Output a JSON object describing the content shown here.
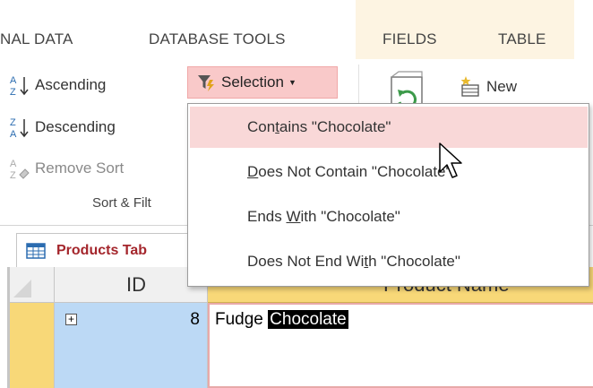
{
  "tabs": [
    {
      "label": "NAL DATA"
    },
    {
      "label": "DATABASE TOOLS"
    },
    {
      "label": "FIELDS"
    },
    {
      "label": "TABLE"
    }
  ],
  "ribbon": {
    "ascending": "Ascending",
    "descending": "Descending",
    "remove_sort": "Remove Sort",
    "selection": "Selection",
    "new": "New",
    "group_label": "Sort & Filt"
  },
  "menu": {
    "items": [
      {
        "before": "Con",
        "key": "t",
        "after": "ains \"Chocolate\"",
        "state": "hover"
      },
      {
        "before": "",
        "key": "D",
        "after": "oes Not Contain \"Chocolate\"",
        "state": "normal"
      },
      {
        "before": "Ends ",
        "key": "W",
        "after": "ith \"Chocolate\"",
        "state": "normal"
      },
      {
        "before": "Does Not End Wi",
        "key": "t",
        "after": "h \"Chocolate\"",
        "state": "normal"
      }
    ]
  },
  "object_tab": {
    "label": "Products Tab"
  },
  "table": {
    "columns": [
      "ID",
      "Product Name"
    ],
    "rows": [
      {
        "id": "8",
        "name_prefix": "Fudge ",
        "name_selected": "Chocolate"
      }
    ]
  },
  "colors": {
    "accent_selection": "#f9c9c9",
    "contextual_tab": "#fdf4e2",
    "header_highlight": "#f8d878",
    "row_highlight": "#bcd9f5"
  }
}
